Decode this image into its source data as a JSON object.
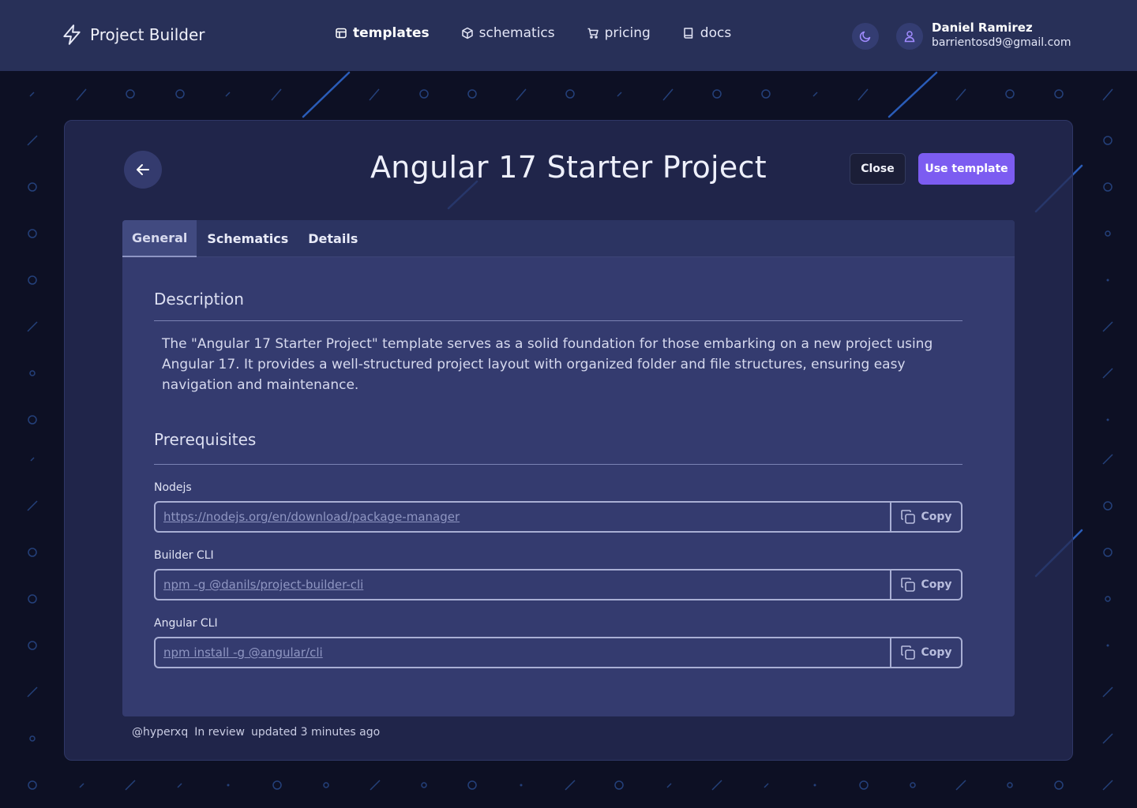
{
  "header": {
    "brand": "Project Builder",
    "nav": [
      {
        "label": "templates",
        "icon": "template-icon"
      },
      {
        "label": "schematics",
        "icon": "cube-icon"
      },
      {
        "label": "pricing",
        "icon": "cart-icon"
      },
      {
        "label": "docs",
        "icon": "book-icon"
      }
    ],
    "user": {
      "name": "Daniel Ramirez",
      "email": "barrientosd9@gmail.com"
    }
  },
  "page": {
    "title": "Angular 17 Starter Project",
    "close_label": "Close",
    "use_label": "Use template"
  },
  "tabs": [
    "General",
    "Schematics",
    "Details"
  ],
  "general": {
    "description_title": "Description",
    "description": "The \"Angular 17 Starter Project\" template serves as a solid foundation for those embarking on a new project using Angular 17. It provides a well-structured project layout with organized folder and file structures, ensuring easy navigation and maintenance.",
    "prerequisites_title": "Prerequisites",
    "prerequisites": [
      {
        "label": "Nodejs",
        "value": "https://nodejs.org/en/download/package-manager",
        "copy": "Copy"
      },
      {
        "label": "Builder CLI",
        "value": "npm -g @danils/project-builder-cli",
        "copy": "Copy"
      },
      {
        "label": "Angular CLI",
        "value": "npm install -g @angular/cli",
        "copy": "Copy"
      }
    ]
  },
  "footer": {
    "author": "@hyperxq",
    "status": "In review",
    "updated": "updated 3 minutes ago"
  },
  "colors": {
    "accent": "#7c5cf1",
    "header": "#283058",
    "background": "#0d1024"
  }
}
